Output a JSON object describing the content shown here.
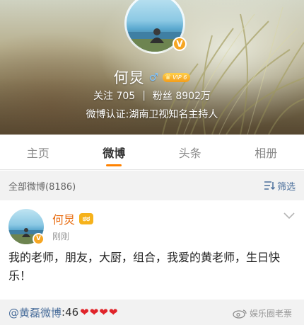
{
  "profile": {
    "name": "何炅",
    "gender_icon": "♂",
    "vip_label": "VIP 6",
    "verified_mark": "V",
    "stats": {
      "following_label": "关注",
      "following_value": "705",
      "separator": "|",
      "fans_label": "粉丝",
      "fans_value": "8902万"
    },
    "verification": "微博认证:湖南卫视知名主持人"
  },
  "tabs": [
    {
      "label": "主页",
      "active": false
    },
    {
      "label": "微博",
      "active": true
    },
    {
      "label": "头条",
      "active": false
    },
    {
      "label": "相册",
      "active": false
    }
  ],
  "filter": {
    "count_text": "全部微博(8186)",
    "filter_label": "筛选"
  },
  "post": {
    "author": "何炅",
    "member_badge": "ಠಠ",
    "time": "刚刚",
    "verified_mark": "V",
    "text": "我的老师，朋友，大厨，组合，我爱的黄老师，生日快乐！"
  },
  "repost": {
    "mention": "@黄磊微博",
    "text": " :46",
    "hearts": "❤❤❤❤"
  },
  "watermark": {
    "text": "娱乐圈老票"
  },
  "colors": {
    "accent": "#ff8200",
    "author": "#e86b0f",
    "link": "#4a6e9b",
    "verified": "#f6a623",
    "heart": "#e0242a"
  }
}
